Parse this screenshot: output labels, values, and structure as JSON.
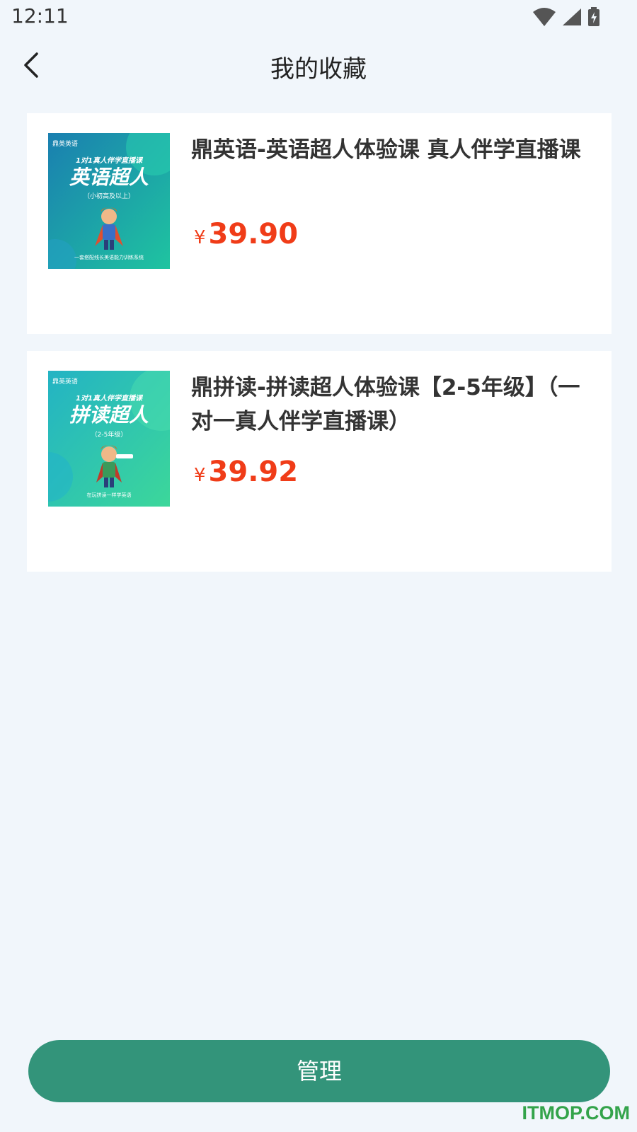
{
  "status_bar": {
    "time": "12:11",
    "icons": [
      "wifi-icon",
      "signal-icon",
      "battery-charging-icon"
    ]
  },
  "header": {
    "back_icon": "chevron-left-icon",
    "title": "我的收藏"
  },
  "favorites": [
    {
      "title": "鼎英语-英语超人体验课 真人伴学直播课",
      "currency": "¥",
      "price": "39.90",
      "thumb": {
        "brand": "鼎英英语",
        "tagline": "1对1真人伴学直播课",
        "headline": "英语超人",
        "sub": "（小初高及以上）",
        "footer": "一套搭配线长美语能力训练系统",
        "colors": [
          "#1a7fb0",
          "#1fc4a0"
        ]
      }
    },
    {
      "title": "鼎拼读-拼读超人体验课【2-5年级】（一对一真人伴学直播课）",
      "currency": "¥",
      "price": "39.92",
      "thumb": {
        "brand": "鼎英英语",
        "tagline": "1对1真人伴学直播课",
        "headline": "拼读超人",
        "sub": "（2-5年级）",
        "footer": "在玩拼读一样学英语",
        "colors": [
          "#23b3c4",
          "#3cd79a"
        ]
      }
    }
  ],
  "manage_button": {
    "label": "管理"
  },
  "watermark": "ITMOP.COM",
  "colors": {
    "background": "#f1f6fb",
    "price": "#f03c18",
    "primary": "#33947a",
    "watermark": "#33a34a"
  }
}
